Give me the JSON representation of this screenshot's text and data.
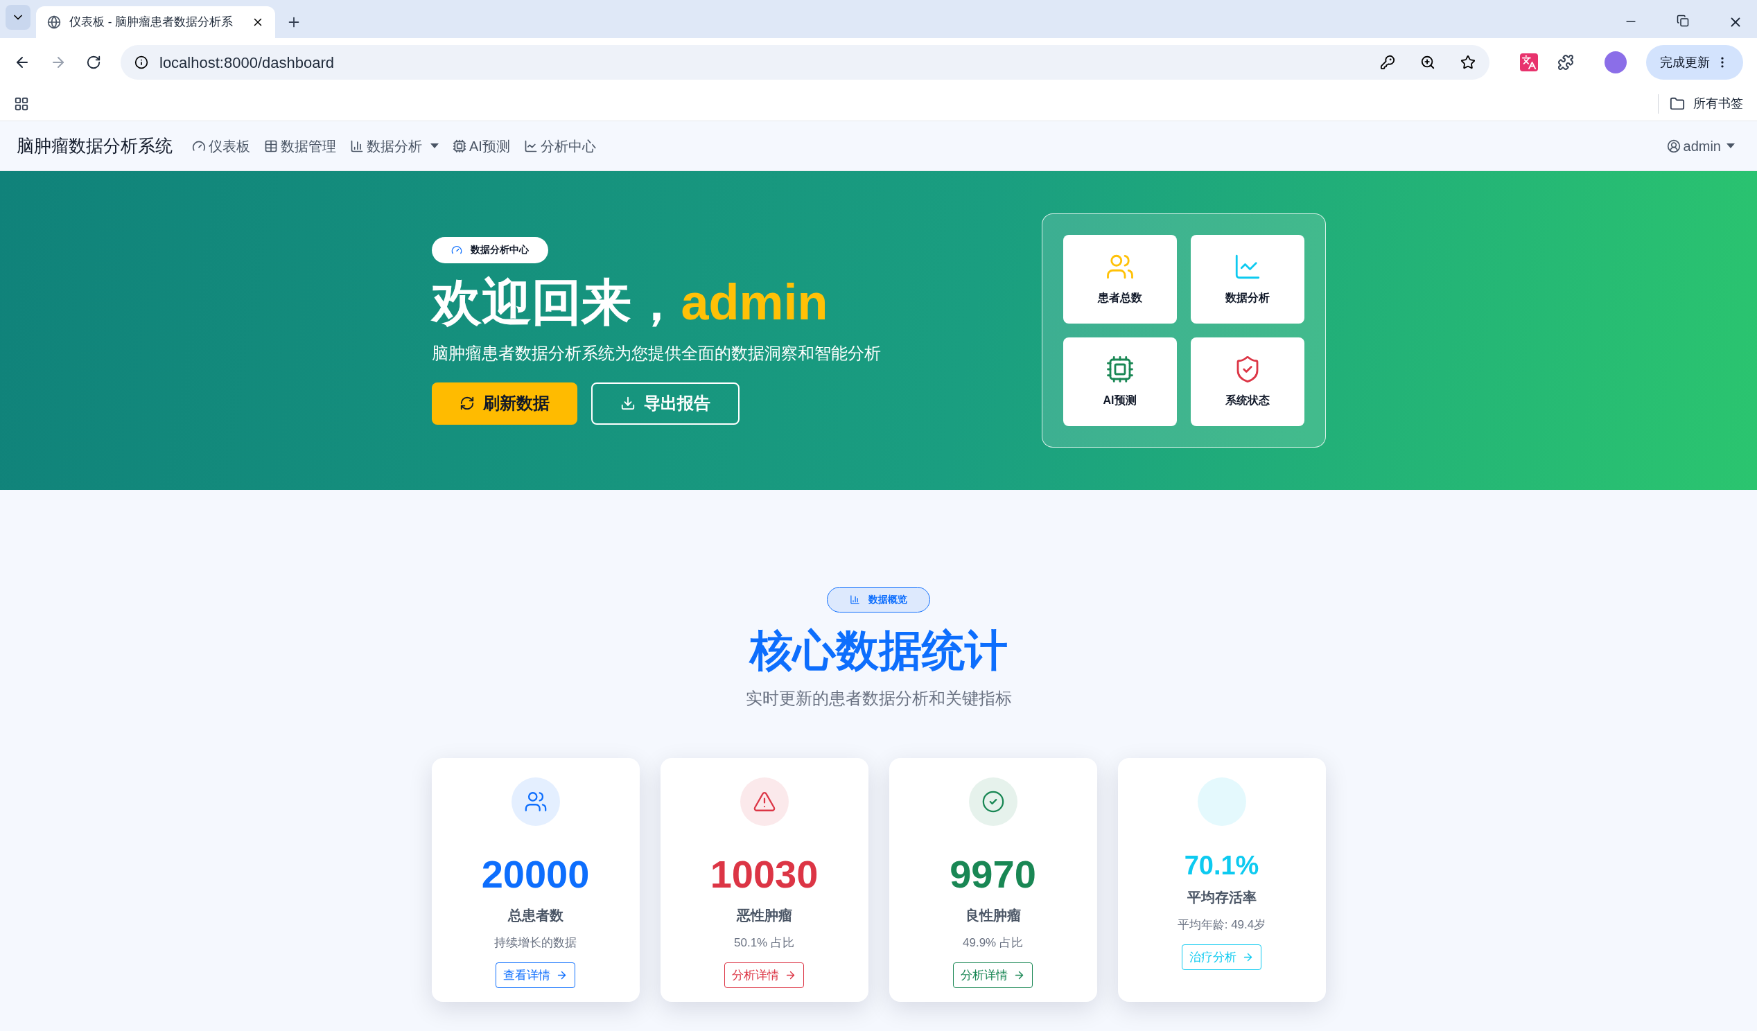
{
  "browser": {
    "tab_title": "仪表板 - 脑肿瘤患者数据分析系",
    "url": "localhost:8000/dashboard",
    "update_button": "完成更新",
    "bookmarks": "所有书签"
  },
  "navbar": {
    "brand": "脑肿瘤数据分析系统",
    "items": [
      {
        "label": "仪表板",
        "kind": "gauge",
        "dropdown": false
      },
      {
        "label": "数据管理",
        "kind": "table",
        "dropdown": false
      },
      {
        "label": "数据分析",
        "kind": "bars",
        "dropdown": true
      },
      {
        "label": "AI预测",
        "kind": "chip",
        "dropdown": false
      },
      {
        "label": "分析中心",
        "kind": "chart",
        "dropdown": false
      }
    ],
    "user": "admin"
  },
  "hero": {
    "badge": "数据分析中心",
    "greeting": "欢迎回来，",
    "username": "admin",
    "subtitle": "脑肿瘤患者数据分析系统为您提供全面的数据洞察和智能分析",
    "buttons": [
      {
        "label": "刷新数据",
        "kind": "primary"
      },
      {
        "label": "导出报告",
        "kind": "outline"
      }
    ],
    "tiles": [
      {
        "label": "患者总数",
        "kind": "people",
        "color": "#ffc107"
      },
      {
        "label": "数据分析",
        "kind": "chart",
        "color": "#0dcaf0"
      },
      {
        "label": "AI预测",
        "kind": "chip",
        "color": "#198754"
      },
      {
        "label": "系统状态",
        "kind": "shield",
        "color": "#dc3545"
      }
    ]
  },
  "overview": {
    "badge": "数据概览",
    "title": "核心数据统计",
    "subtitle": "实时更新的患者数据分析和关键指标",
    "cards": [
      {
        "kind": "people",
        "color": "#0d6efd",
        "value": "20000",
        "label": "总患者数",
        "note": "持续增长的数据",
        "link": "查看详情"
      },
      {
        "kind": "warning",
        "color": "#dc3545",
        "value": "10030",
        "label": "恶性肿瘤",
        "note": "50.1% 占比",
        "link": "分析详情"
      },
      {
        "kind": "check",
        "color": "#198754",
        "value": "9970",
        "label": "良性肿瘤",
        "note": "49.9% 占比",
        "link": "分析详情"
      },
      {
        "kind": "none",
        "color": "#0dcaf0",
        "value": "70.1%",
        "label": "平均存活率",
        "note": "平均年龄: 49.4岁",
        "link": "治疗分析"
      }
    ]
  }
}
